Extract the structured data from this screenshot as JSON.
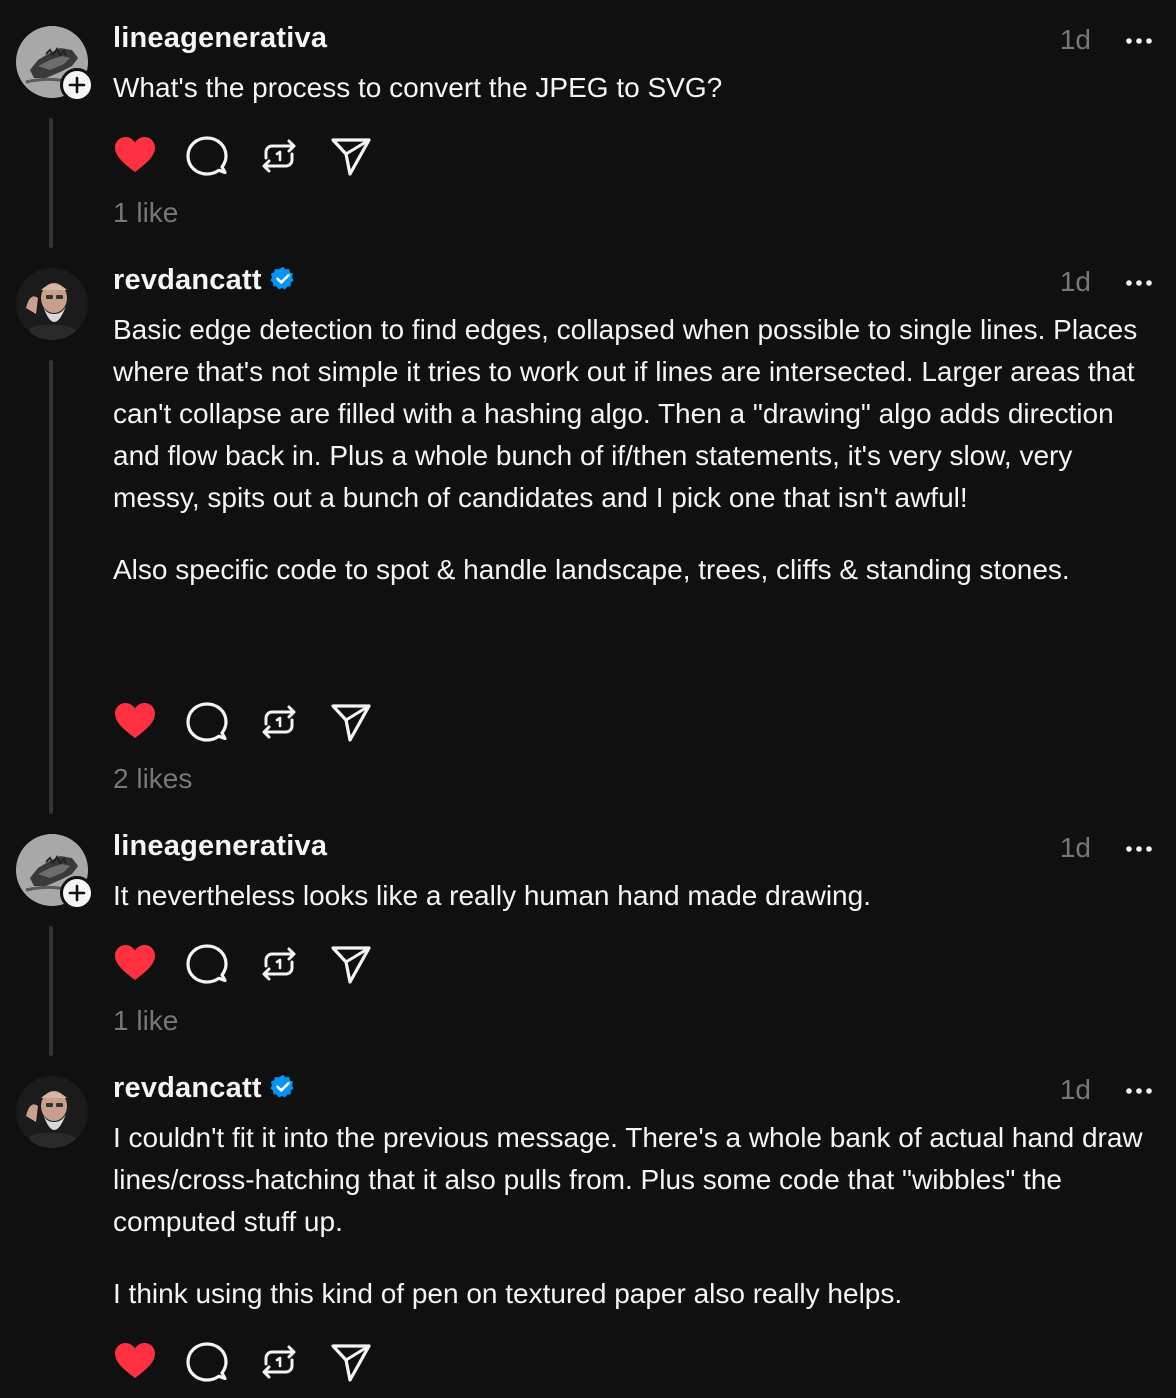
{
  "posts": [
    {
      "username": "lineagenerativa",
      "verified": false,
      "time": "1d",
      "paragraphs": [
        "What's the process to convert the JPEG to SVG?"
      ],
      "likes": "1 like",
      "liked": true
    },
    {
      "username": "revdancatt",
      "verified": true,
      "time": "1d",
      "paragraphs": [
        "Basic edge detection to find edges, collapsed when possible to single lines. Places where that's not simple it tries to work out if lines are intersected. Larger areas that can't collapse are filled with a hashing algo. Then a \"drawing\" algo adds direction and flow back in. Plus a whole bunch of if/then statements, it's very slow, very messy, spits out a bunch of candidates and I pick one that isn't awful!",
        "Also specific code to spot & handle landscape, trees, cliffs & standing stones."
      ],
      "likes": "2 likes",
      "liked": true
    },
    {
      "username": "lineagenerativa",
      "verified": false,
      "time": "1d",
      "paragraphs": [
        "It nevertheless looks like a really human hand made drawing."
      ],
      "likes": "1 like",
      "liked": true
    },
    {
      "username": "revdancatt",
      "verified": true,
      "time": "1d",
      "paragraphs": [
        "I couldn't fit it into the previous message. There's a whole bank of actual hand draw lines/cross-hatching that it also pulls from. Plus some code that \"wibbles\" the computed stuff up.",
        "I think using this kind of pen on textured paper also really helps."
      ],
      "likes": "",
      "liked": true
    }
  ],
  "icons": {
    "like": "heart-icon",
    "reply": "speech-bubble-icon",
    "repost": "repost-arrows-icon",
    "share": "send-icon",
    "more": "ellipsis-icon",
    "follow": "plus-icon",
    "verified": "verified-badge-icon"
  },
  "colors": {
    "background": "#101010",
    "text": "#f3f5f7",
    "secondary": "#777777",
    "like": "#ff3040",
    "verified": "#0095f6",
    "thread_line": "#333638"
  }
}
